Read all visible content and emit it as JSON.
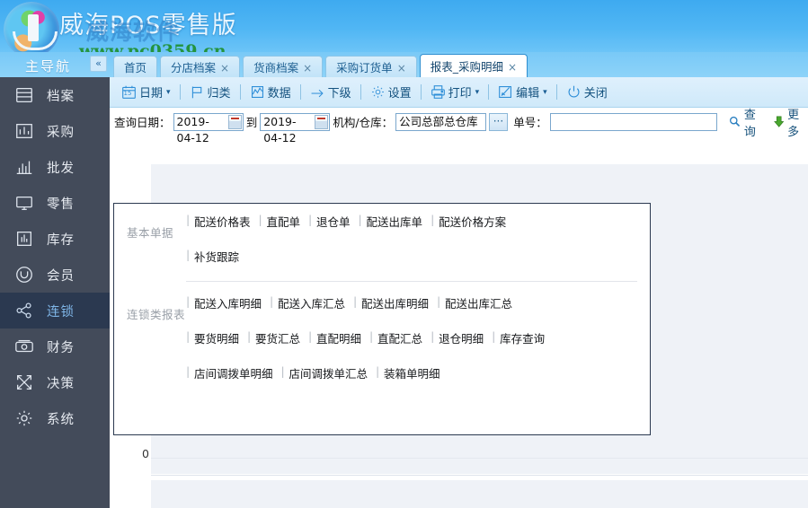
{
  "window": {
    "app_title": "威海POS零售版",
    "watermark_brand": "威海软件",
    "watermark_url": "www.pc0359.cn",
    "logo_icon": "company-logo-icon"
  },
  "nav": {
    "title": "主导航",
    "collapse_label": "«"
  },
  "tabs": [
    {
      "label": "首页",
      "closable": false,
      "active": false
    },
    {
      "label": "分店档案",
      "close": "×",
      "closable": true,
      "active": false
    },
    {
      "label": "货商档案",
      "close": "×",
      "closable": true,
      "active": false
    },
    {
      "label": "采购订货单",
      "close": "×",
      "closable": true,
      "active": false
    },
    {
      "label": "报表_采购明细",
      "close": "×",
      "closable": true,
      "active": true
    }
  ],
  "sidebar": {
    "items": [
      {
        "label": "档案",
        "icon": "list-lines-icon",
        "active": false
      },
      {
        "label": "采购",
        "icon": "bar-chart-box-icon",
        "active": false
      },
      {
        "label": "批发",
        "icon": "bar-chart-icon",
        "active": false
      },
      {
        "label": "零售",
        "icon": "monitor-icon",
        "active": false
      },
      {
        "label": "库存",
        "icon": "chart-frame-icon",
        "active": false
      },
      {
        "label": "会员",
        "icon": "member-circle-icon",
        "active": false
      },
      {
        "label": "连锁",
        "icon": "share-nodes-icon",
        "active": true
      },
      {
        "label": "财务",
        "icon": "banknote-icon",
        "active": false
      },
      {
        "label": "决策",
        "icon": "arrows-cross-icon",
        "active": false
      },
      {
        "label": "系统",
        "icon": "gear-icon",
        "active": false
      }
    ]
  },
  "toolbar": {
    "buttons": [
      {
        "label": "日期",
        "icon": "calendar-icon",
        "badge": "15",
        "caret": "▾"
      },
      {
        "label": "归类",
        "icon": "flag-icon",
        "caret": ""
      },
      {
        "label": "数据",
        "icon": "data-chart-icon",
        "caret": ""
      },
      {
        "label": "下级",
        "icon": "arrow-right-icon",
        "caret": ""
      },
      {
        "label": "设置",
        "icon": "gear-icon",
        "caret": ""
      },
      {
        "label": "打印",
        "icon": "printer-icon",
        "caret": "▾"
      },
      {
        "label": "编辑",
        "icon": "pencil-edit-icon",
        "caret": "▾"
      },
      {
        "label": "关闭",
        "icon": "power-icon",
        "caret": ""
      }
    ]
  },
  "filter": {
    "date_label": "查询日期：",
    "date_from": "2019-04-12",
    "to_label": "到",
    "date_to": "2019-04-12",
    "org_label": "机构/仓库：",
    "org_value": "公司总部总仓库",
    "browse_label": "···",
    "billno_label": "单号：",
    "billno_value": "",
    "billno_placeholder": "",
    "search_label": "查询",
    "search_icon": "magnifier-icon",
    "more_label": "更多",
    "more_icon": "down-arrow-icon"
  },
  "popup": {
    "sections": [
      {
        "title": "基本单据",
        "rows": [
          [
            "配送价格表",
            "直配单",
            "退仓单",
            "配送出库单",
            "配送价格方案"
          ],
          [
            "补货跟踪"
          ]
        ]
      },
      {
        "title": "连锁类报表",
        "rows": [
          [
            "配送入库明细",
            "配送入库汇总",
            "配送出库明细",
            "配送出库汇总"
          ],
          [
            "要货明细",
            "要货汇总",
            "直配明细",
            "直配汇总",
            "退仓明细",
            "库存查询"
          ],
          [
            "店间调拨单明细",
            "店间调拨单汇总",
            "装箱单明细"
          ]
        ]
      }
    ]
  },
  "grid": {
    "row_number": "0"
  },
  "colors": {
    "header_blue": "#50b6f4",
    "tab_blue": "#8fd4f9",
    "sidebar_dark": "#434b5a",
    "sidebar_active": "#2b3950",
    "accent_link": "#7fb6e8",
    "toolbar_blue": "#cfe9fa",
    "workarea_bg": "#eff2f7",
    "watermark_green": "#1d8f2c"
  }
}
